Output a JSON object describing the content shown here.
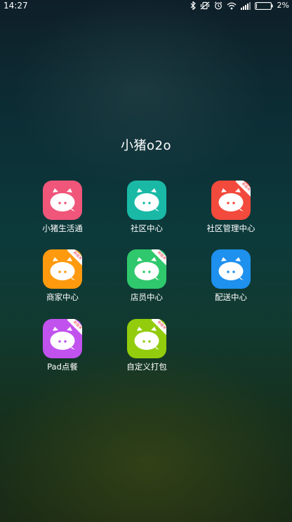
{
  "status_bar": {
    "time": "14:27",
    "battery_percent": "2%",
    "icons": [
      "bluetooth-icon",
      "vibrate-mute-icon",
      "alarm-icon",
      "wifi-icon",
      "signal-icon",
      "battery-icon"
    ]
  },
  "folder": {
    "title": "小猪o2o"
  },
  "apps": [
    {
      "label": "小猪生活通",
      "color": "#f0567a",
      "badge": ""
    },
    {
      "label": "社区中心",
      "color": "#19b9a6",
      "badge": ""
    },
    {
      "label": "社区管理中心",
      "color": "#f24a3c",
      "badge": "新版本"
    },
    {
      "label": "商家中心",
      "color": "#ff9a0e",
      "badge": "新版本"
    },
    {
      "label": "店员中心",
      "color": "#2fc86c",
      "badge": "新版本"
    },
    {
      "label": "配送中心",
      "color": "#1e90ee",
      "badge": ""
    },
    {
      "label": "Pad点餐",
      "color": "#c152ee",
      "badge": "新版本"
    },
    {
      "label": "自定义打包",
      "color": "#92cc0c",
      "badge": "新版本"
    }
  ]
}
